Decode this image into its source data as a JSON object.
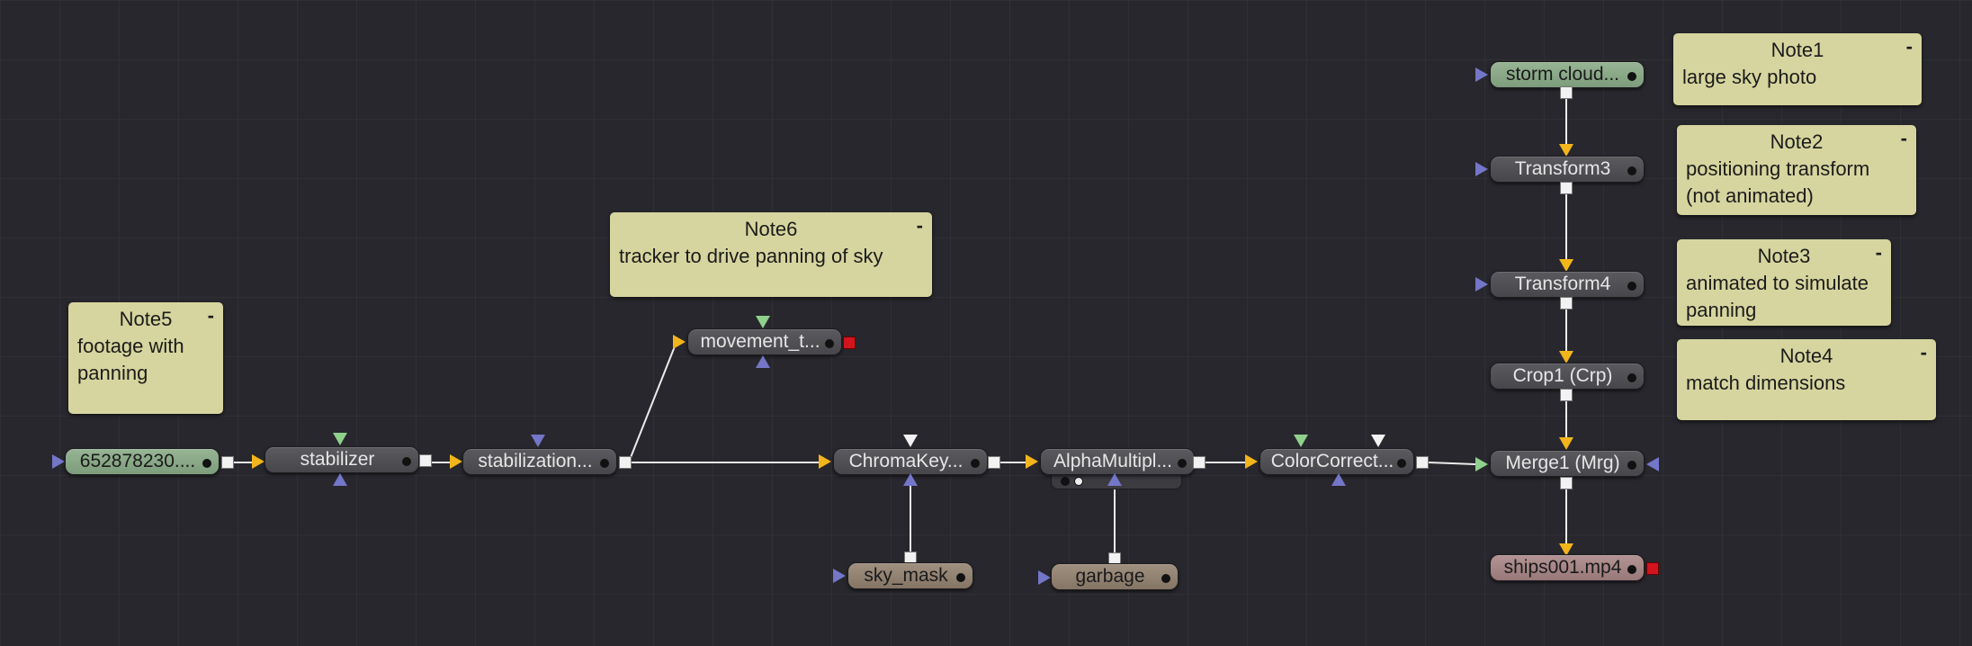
{
  "nodes": {
    "media_in": "652878230....",
    "stabilizer": "stabilizer",
    "stabilization": "stabilization...",
    "movement": "movement_t...",
    "chromakey": "ChromaKey...",
    "alphamultiply": "AlphaMultipl...",
    "colorcorrect": "ColorCorrect...",
    "merge1": "Merge1  (Mrg)",
    "storm": "storm cloud...",
    "transform3": "Transform3",
    "transform4": "Transform4",
    "crop1": "Crop1  (Crp)",
    "ships": "ships001.mp4",
    "sky_mask": "sky_mask",
    "garbage": "garbage"
  },
  "notes": {
    "note1": {
      "title": "Note1",
      "body": "large sky photo"
    },
    "note2": {
      "title": "Note2",
      "body": "positioning transform (not animated)"
    },
    "note3": {
      "title": "Note3",
      "body": "animated to simulate panning"
    },
    "note4": {
      "title": "Note4",
      "body": "match dimensions"
    },
    "note5": {
      "title": "Note5",
      "body": "footage with panning"
    },
    "note6": {
      "title": "Note6",
      "body": "tracker to drive panning of sky"
    }
  },
  "ui": {
    "minimize": "-"
  },
  "colors": {
    "background": "#27272d",
    "node_gray": "#4f4f54",
    "node_loader_green": "#8aa988",
    "node_mask_brown": "#948472",
    "node_saver_pink": "#a88686",
    "note_yellow": "#d6d59f",
    "input_yellow": "#f3b51c",
    "input_blue": "#7476c8",
    "input_green": "#8fd18c",
    "saver_red": "#d2141d"
  }
}
